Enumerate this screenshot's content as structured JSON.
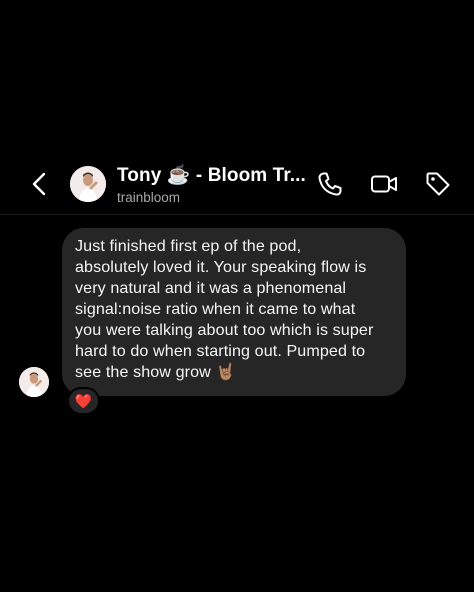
{
  "header": {
    "contact_name": "Tony ☕ - Bloom Tr...",
    "username": "trainbloom"
  },
  "icons": {
    "back": "chevron-left-icon",
    "call": "phone-icon",
    "video": "video-camera-icon",
    "tag": "tag-icon"
  },
  "message": {
    "text": "Just finished first ep of the pod,\nabsolutely loved it. Your speaking flow is\nvery natural and it was a phenomenal\nsignal:noise ratio when it came to what\nyou were talking about too which is super\nhard to do when starting out. Pumped to\nsee the show grow 🤘🏽",
    "reaction": "❤️"
  },
  "colors": {
    "background": "#000000",
    "bubble": "#262626",
    "secondary_text": "#a8a8a8",
    "heart": "#ed1c24"
  }
}
